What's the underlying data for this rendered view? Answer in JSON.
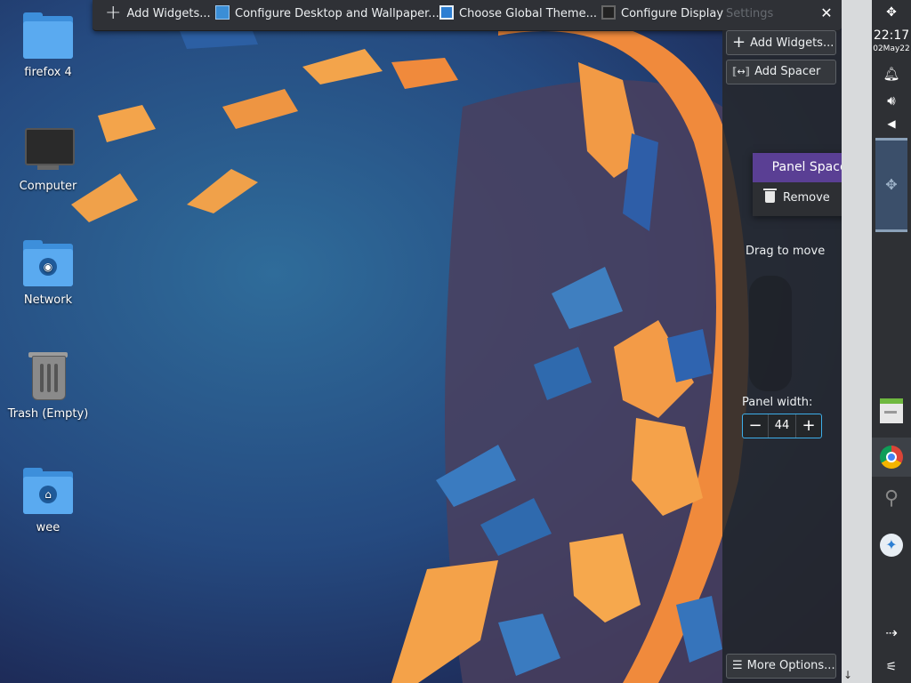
{
  "toolbar": {
    "add_widgets": "Add Widgets...",
    "configure_desktop": "Configure Desktop and Wallpaper...",
    "choose_theme": "Choose Global Theme...",
    "configure_display": "Configure Display",
    "ghost_label": "Settings",
    "close": "✕"
  },
  "desktop_icons": [
    {
      "label": "firefox 4"
    },
    {
      "label": "Computer"
    },
    {
      "label": "Network"
    },
    {
      "label": "Trash (Empty)"
    },
    {
      "label": "wee"
    }
  ],
  "panel_config": {
    "add_widgets": "Add Widgets...",
    "add_spacer": "Add Spacer",
    "drag_to_move": "Drag to move",
    "panel_width_label": "Panel width:",
    "panel_width_value": "44",
    "more_options": "More Options..."
  },
  "popup": {
    "title": "Panel Spacer",
    "remove": "Remove"
  },
  "right_panel": {
    "time": "22:17",
    "date": "02May22"
  },
  "colors": {
    "accent": "#3daee9",
    "popup_header": "#5a3f94",
    "panel_bg": "#2e3034"
  }
}
